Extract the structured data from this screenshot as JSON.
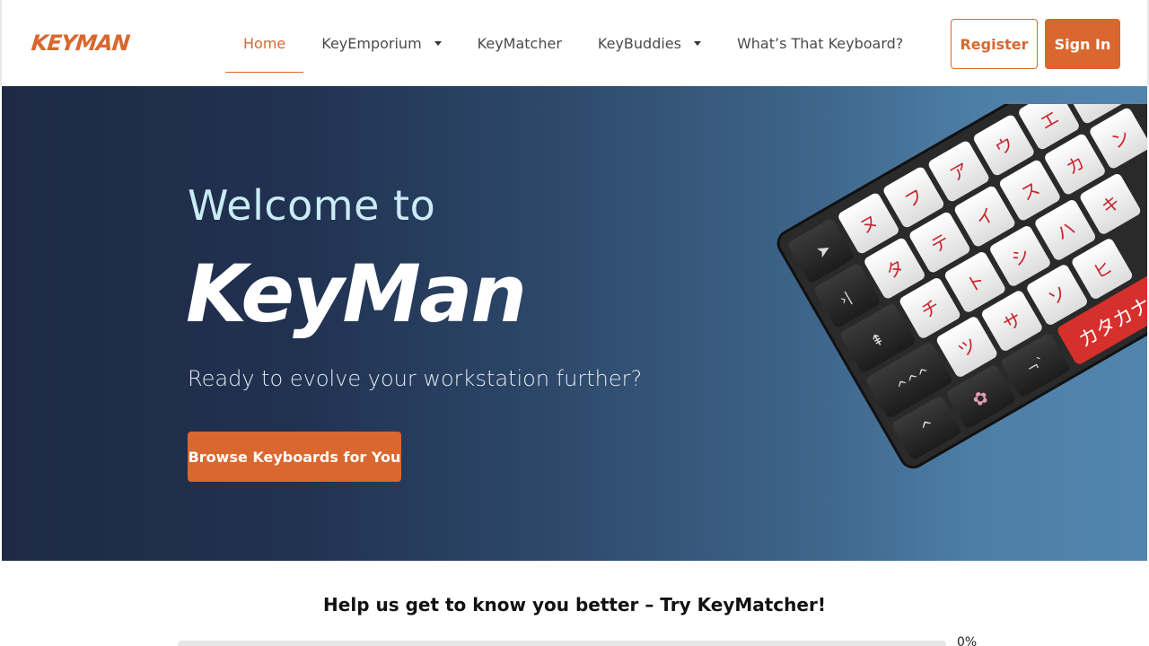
{
  "header": {
    "logo": "KEYMAN",
    "nav": [
      {
        "label": "Home",
        "active": true,
        "dropdown": false
      },
      {
        "label": "KeyEmporium",
        "active": false,
        "dropdown": true
      },
      {
        "label": "KeyMatcher",
        "active": false,
        "dropdown": false
      },
      {
        "label": "KeyBuddies",
        "active": false,
        "dropdown": true
      },
      {
        "label": "What’s That Keyboard?",
        "active": false,
        "dropdown": false
      }
    ],
    "register_label": "Register",
    "signin_label": "Sign In"
  },
  "hero": {
    "welcome": "Welcome to",
    "brand": "KeyMan",
    "tagline": "Ready to evolve your workstation further?",
    "cta_label": "Browse Keyboards for You",
    "keycap_badge": "カタカナ"
  },
  "quiz": {
    "prompt": "Help us get to know you better – Try KeyMatcher!",
    "progress_label": "0%",
    "progress": 0
  },
  "colors": {
    "accent": "#d9672f",
    "hero_dark": "#1e2a45",
    "hero_light": "#5285ae"
  }
}
